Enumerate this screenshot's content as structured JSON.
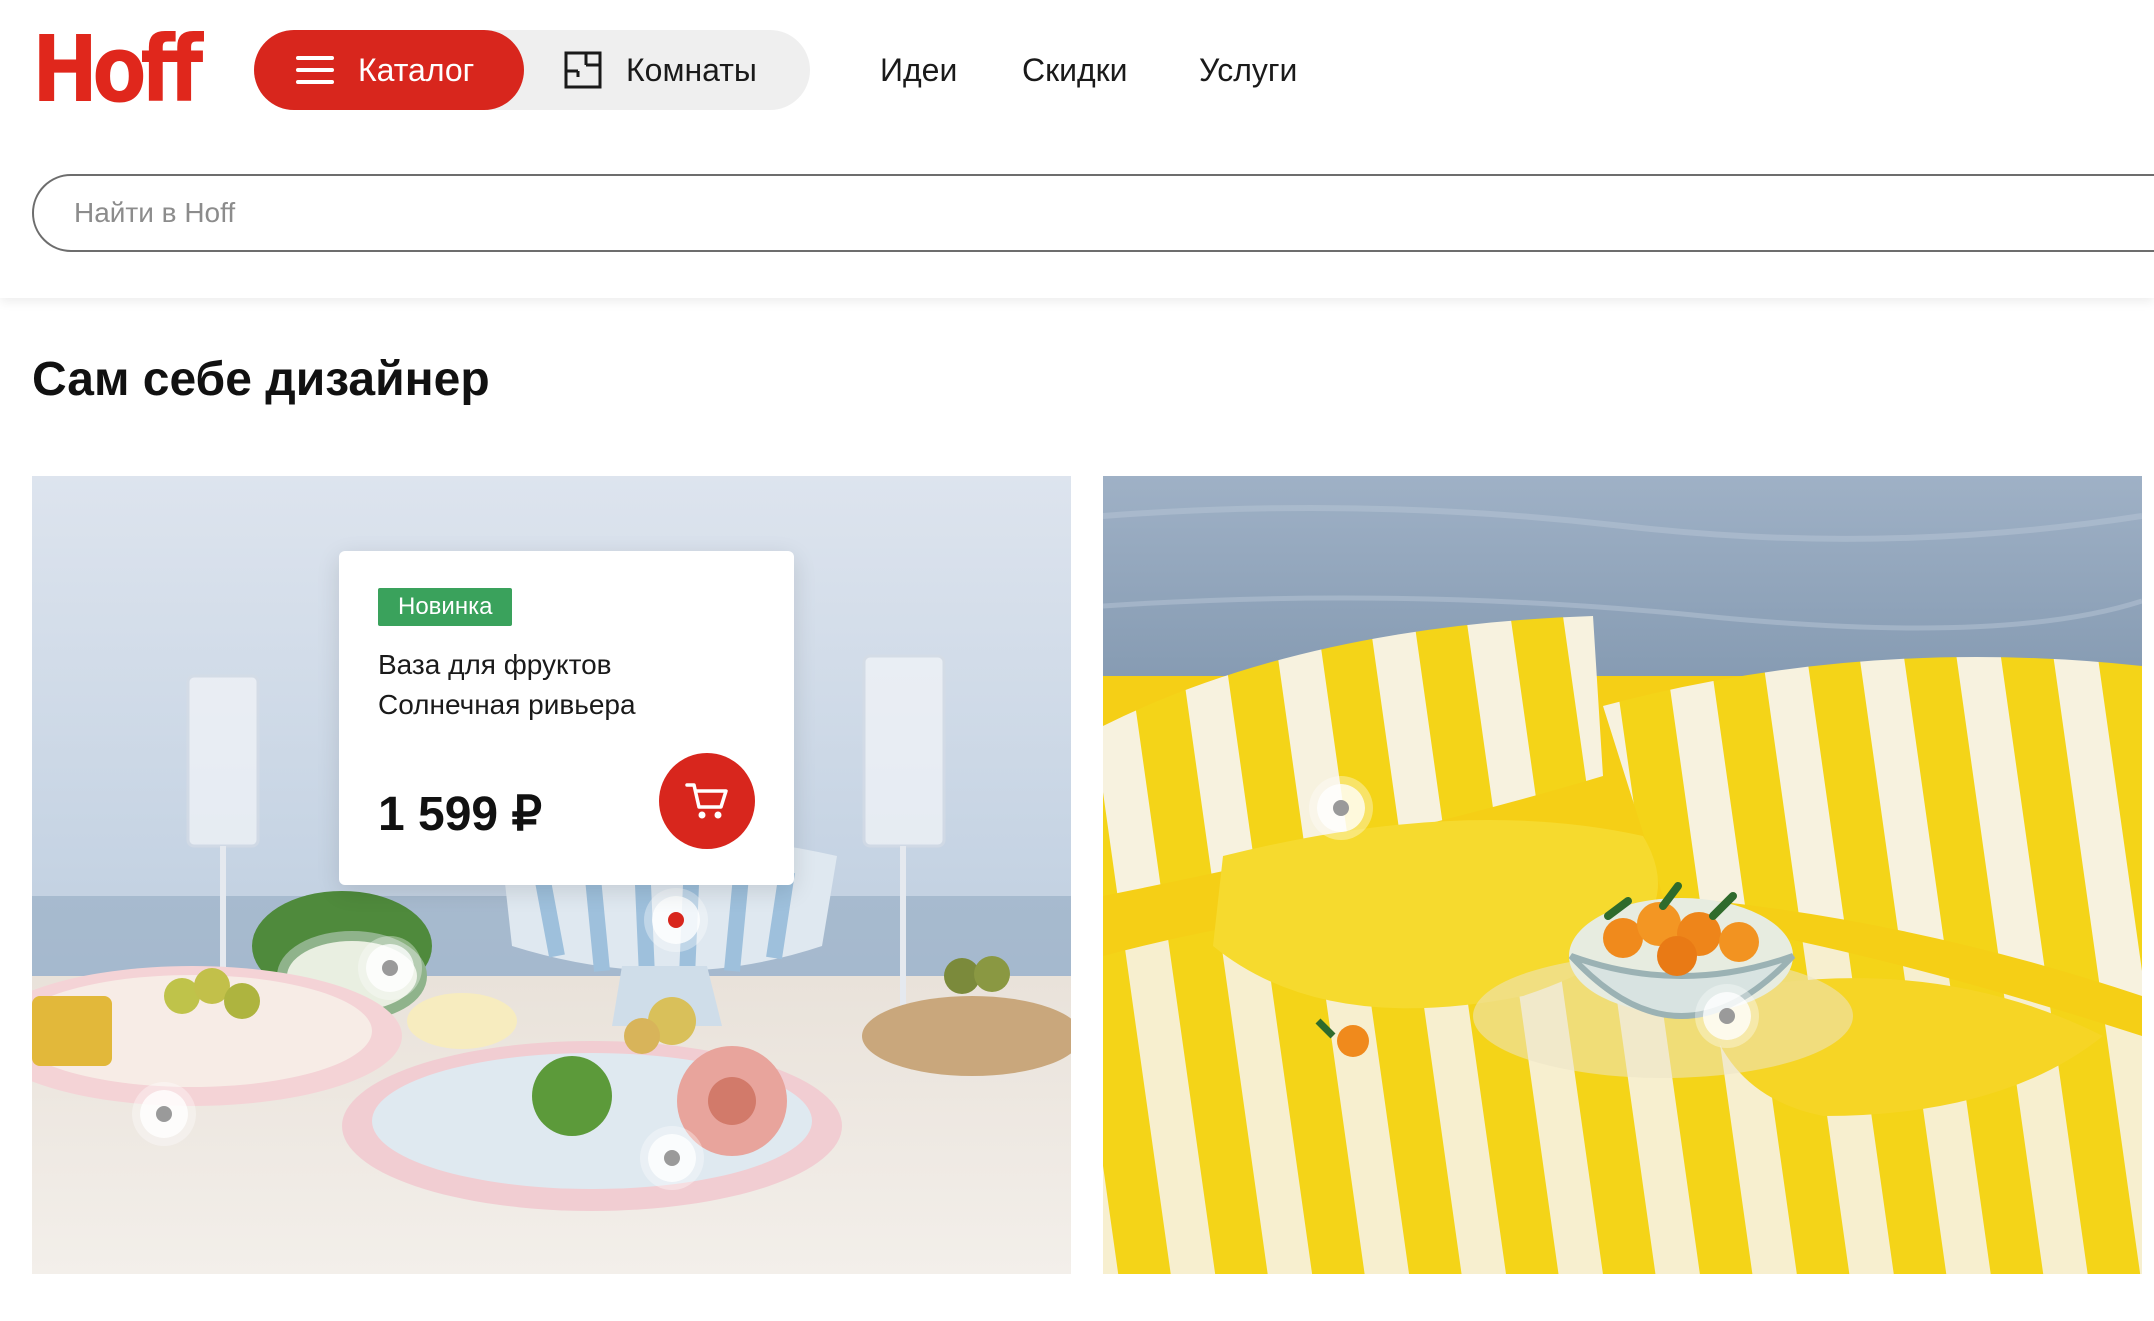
{
  "header": {
    "logo": "Hoff",
    "catalog_label": "Каталог",
    "rooms_label": "Комнаты",
    "nav": {
      "ideas": "Идеи",
      "discounts": "Скидки",
      "services": "Услуги"
    },
    "search_placeholder": "Найти в Hoff"
  },
  "section": {
    "title": "Сам себе дизайнер"
  },
  "product_card": {
    "badge": "Новинка",
    "title": "Ваза для фруктов Солнечная ривьера",
    "price": "1 599 ₽"
  },
  "icons": [
    "menu-icon",
    "floorplan-icon",
    "cart-icon"
  ],
  "colors": {
    "brand_red": "#d8261d",
    "badge_green": "#3aa25c"
  }
}
